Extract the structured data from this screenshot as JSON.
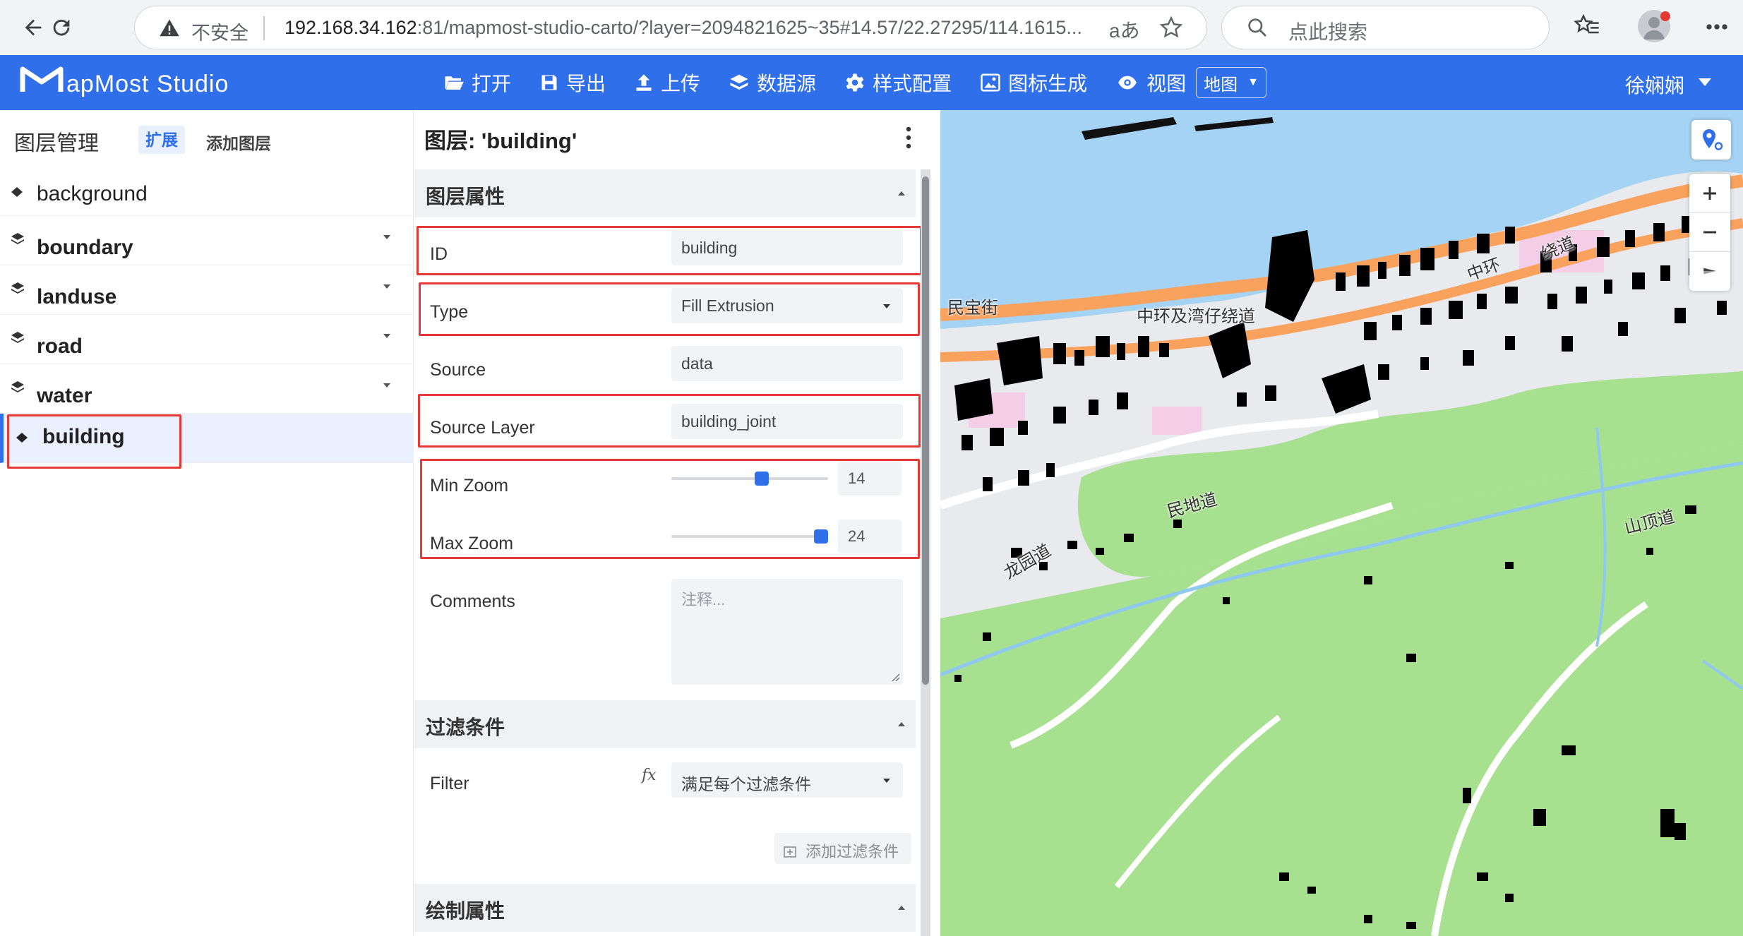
{
  "browser": {
    "insecure_label": "不安全",
    "url_host": "192.168.34.162",
    "url_rest": ":81/mapmost-studio-carto/?layer=2094821625~35#14.57/22.27295/114.1615...",
    "reader_label": "aあ",
    "search_placeholder": "点此搜索"
  },
  "app": {
    "logo_text": "apMost Studio",
    "toolbar": {
      "open": "打开",
      "export": "导出",
      "upload": "上传",
      "datasource": "数据源",
      "style_config": "样式配置",
      "icon_gen": "图标生成",
      "view": "视图",
      "view_value": "地图"
    },
    "user": "徐娴娴"
  },
  "layers": {
    "title": "图层管理",
    "expand": "扩展",
    "add": "添加图层",
    "items": [
      {
        "label": "background"
      },
      {
        "label": "boundary"
      },
      {
        "label": "landuse"
      },
      {
        "label": "road"
      },
      {
        "label": "water"
      },
      {
        "label": "building"
      }
    ]
  },
  "props": {
    "title": "图层: 'building'",
    "section_layer": "图层属性",
    "section_filter": "过滤条件",
    "section_paint": "绘制属性",
    "id_label": "ID",
    "id_value": "building",
    "type_label": "Type",
    "type_value": "Fill Extrusion",
    "source_label": "Source",
    "source_value": "data",
    "source_layer_label": "Source Layer",
    "source_layer_value": "building_joint",
    "min_zoom_label": "Min Zoom",
    "min_zoom_value": "14",
    "max_zoom_label": "Max Zoom",
    "max_zoom_value": "24",
    "comments_label": "Comments",
    "comments_placeholder": "注释...",
    "filter_label": "Filter",
    "filter_fx": "fx",
    "filter_value": "满足每个过滤条件",
    "add_filter": "添加过滤条件"
  },
  "zoom": {
    "min": 14,
    "max": 24,
    "range_max": 24
  },
  "map": {
    "labels": [
      {
        "text": "民宝街"
      },
      {
        "text": "中环及湾仔绕道"
      },
      {
        "text": "中环"
      },
      {
        "text": "绕道"
      },
      {
        "text": "民地道"
      },
      {
        "text": "龙园道"
      },
      {
        "text": "山顶道"
      }
    ]
  },
  "colors": {
    "accent": "#2f6fea",
    "highlight": "#e53935",
    "water": "#a5d3f4",
    "park": "#a7e08e",
    "road_major": "#f9a25e",
    "building": "#000000"
  }
}
